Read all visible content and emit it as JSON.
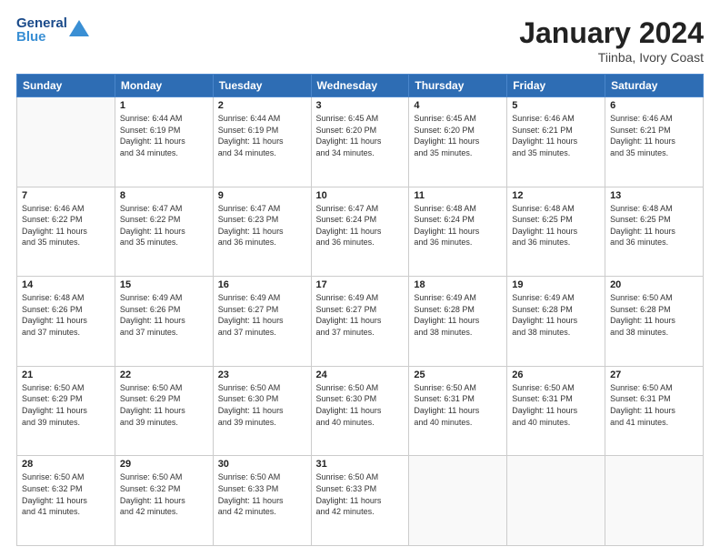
{
  "header": {
    "logo_general": "General",
    "logo_blue": "Blue",
    "month_title": "January 2024",
    "location": "Tiinba, Ivory Coast"
  },
  "days_of_week": [
    "Sunday",
    "Monday",
    "Tuesday",
    "Wednesday",
    "Thursday",
    "Friday",
    "Saturday"
  ],
  "weeks": [
    [
      {
        "day": "",
        "info": ""
      },
      {
        "day": "1",
        "info": "Sunrise: 6:44 AM\nSunset: 6:19 PM\nDaylight: 11 hours\nand 34 minutes."
      },
      {
        "day": "2",
        "info": "Sunrise: 6:44 AM\nSunset: 6:19 PM\nDaylight: 11 hours\nand 34 minutes."
      },
      {
        "day": "3",
        "info": "Sunrise: 6:45 AM\nSunset: 6:20 PM\nDaylight: 11 hours\nand 34 minutes."
      },
      {
        "day": "4",
        "info": "Sunrise: 6:45 AM\nSunset: 6:20 PM\nDaylight: 11 hours\nand 35 minutes."
      },
      {
        "day": "5",
        "info": "Sunrise: 6:46 AM\nSunset: 6:21 PM\nDaylight: 11 hours\nand 35 minutes."
      },
      {
        "day": "6",
        "info": "Sunrise: 6:46 AM\nSunset: 6:21 PM\nDaylight: 11 hours\nand 35 minutes."
      }
    ],
    [
      {
        "day": "7",
        "info": "Sunrise: 6:46 AM\nSunset: 6:22 PM\nDaylight: 11 hours\nand 35 minutes."
      },
      {
        "day": "8",
        "info": "Sunrise: 6:47 AM\nSunset: 6:22 PM\nDaylight: 11 hours\nand 35 minutes."
      },
      {
        "day": "9",
        "info": "Sunrise: 6:47 AM\nSunset: 6:23 PM\nDaylight: 11 hours\nand 36 minutes."
      },
      {
        "day": "10",
        "info": "Sunrise: 6:47 AM\nSunset: 6:24 PM\nDaylight: 11 hours\nand 36 minutes."
      },
      {
        "day": "11",
        "info": "Sunrise: 6:48 AM\nSunset: 6:24 PM\nDaylight: 11 hours\nand 36 minutes."
      },
      {
        "day": "12",
        "info": "Sunrise: 6:48 AM\nSunset: 6:25 PM\nDaylight: 11 hours\nand 36 minutes."
      },
      {
        "day": "13",
        "info": "Sunrise: 6:48 AM\nSunset: 6:25 PM\nDaylight: 11 hours\nand 36 minutes."
      }
    ],
    [
      {
        "day": "14",
        "info": "Sunrise: 6:48 AM\nSunset: 6:26 PM\nDaylight: 11 hours\nand 37 minutes."
      },
      {
        "day": "15",
        "info": "Sunrise: 6:49 AM\nSunset: 6:26 PM\nDaylight: 11 hours\nand 37 minutes."
      },
      {
        "day": "16",
        "info": "Sunrise: 6:49 AM\nSunset: 6:27 PM\nDaylight: 11 hours\nand 37 minutes."
      },
      {
        "day": "17",
        "info": "Sunrise: 6:49 AM\nSunset: 6:27 PM\nDaylight: 11 hours\nand 37 minutes."
      },
      {
        "day": "18",
        "info": "Sunrise: 6:49 AM\nSunset: 6:28 PM\nDaylight: 11 hours\nand 38 minutes."
      },
      {
        "day": "19",
        "info": "Sunrise: 6:49 AM\nSunset: 6:28 PM\nDaylight: 11 hours\nand 38 minutes."
      },
      {
        "day": "20",
        "info": "Sunrise: 6:50 AM\nSunset: 6:28 PM\nDaylight: 11 hours\nand 38 minutes."
      }
    ],
    [
      {
        "day": "21",
        "info": "Sunrise: 6:50 AM\nSunset: 6:29 PM\nDaylight: 11 hours\nand 39 minutes."
      },
      {
        "day": "22",
        "info": "Sunrise: 6:50 AM\nSunset: 6:29 PM\nDaylight: 11 hours\nand 39 minutes."
      },
      {
        "day": "23",
        "info": "Sunrise: 6:50 AM\nSunset: 6:30 PM\nDaylight: 11 hours\nand 39 minutes."
      },
      {
        "day": "24",
        "info": "Sunrise: 6:50 AM\nSunset: 6:30 PM\nDaylight: 11 hours\nand 40 minutes."
      },
      {
        "day": "25",
        "info": "Sunrise: 6:50 AM\nSunset: 6:31 PM\nDaylight: 11 hours\nand 40 minutes."
      },
      {
        "day": "26",
        "info": "Sunrise: 6:50 AM\nSunset: 6:31 PM\nDaylight: 11 hours\nand 40 minutes."
      },
      {
        "day": "27",
        "info": "Sunrise: 6:50 AM\nSunset: 6:31 PM\nDaylight: 11 hours\nand 41 minutes."
      }
    ],
    [
      {
        "day": "28",
        "info": "Sunrise: 6:50 AM\nSunset: 6:32 PM\nDaylight: 11 hours\nand 41 minutes."
      },
      {
        "day": "29",
        "info": "Sunrise: 6:50 AM\nSunset: 6:32 PM\nDaylight: 11 hours\nand 42 minutes."
      },
      {
        "day": "30",
        "info": "Sunrise: 6:50 AM\nSunset: 6:33 PM\nDaylight: 11 hours\nand 42 minutes."
      },
      {
        "day": "31",
        "info": "Sunrise: 6:50 AM\nSunset: 6:33 PM\nDaylight: 11 hours\nand 42 minutes."
      },
      {
        "day": "",
        "info": ""
      },
      {
        "day": "",
        "info": ""
      },
      {
        "day": "",
        "info": ""
      }
    ]
  ]
}
